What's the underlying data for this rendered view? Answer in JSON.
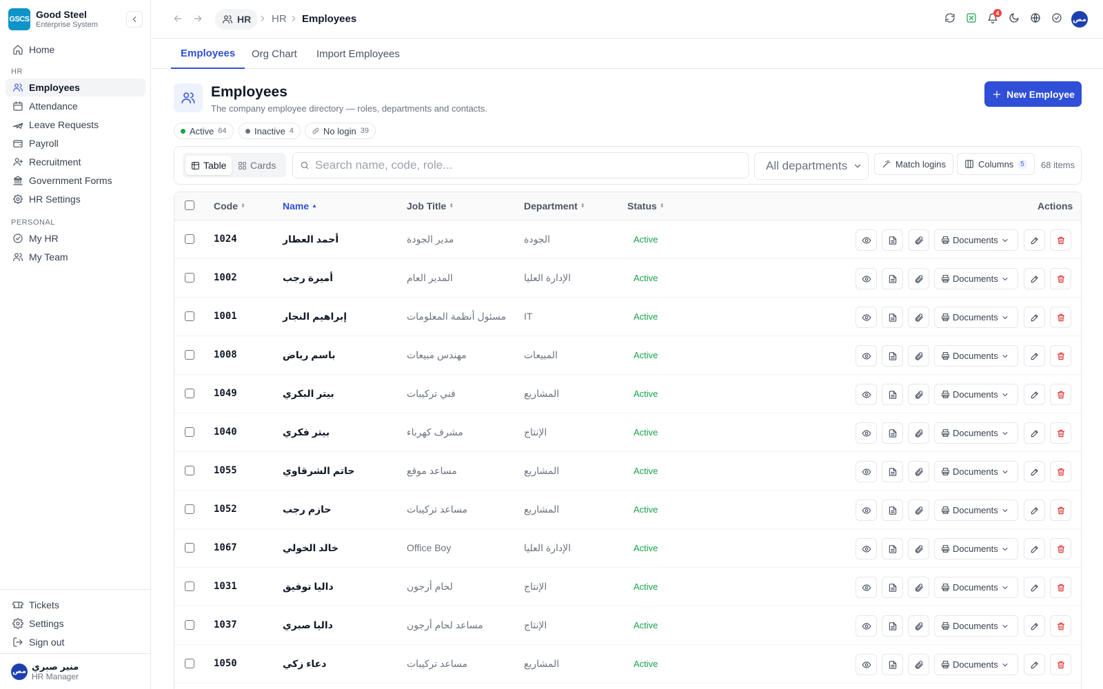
{
  "brand": {
    "logo_text": "GSCS",
    "name": "Good Steel",
    "subtitle": "Enterprise System"
  },
  "sidebar": {
    "home": "Home",
    "hr_section": "HR",
    "hr_items": [
      {
        "label": "Employees",
        "icon": "users-icon",
        "active": true
      },
      {
        "label": "Attendance",
        "icon": "calendar-icon"
      },
      {
        "label": "Leave Requests",
        "icon": "plane-icon"
      },
      {
        "label": "Payroll",
        "icon": "wallet-icon"
      },
      {
        "label": "Recruitment",
        "icon": "user-plus-icon"
      },
      {
        "label": "Government Forms",
        "icon": "landmark-icon"
      },
      {
        "label": "HR Settings",
        "icon": "cog-icon"
      }
    ],
    "personal_section": "PERSONAL",
    "personal_items": [
      {
        "label": "My HR",
        "icon": "check-circle-icon"
      },
      {
        "label": "My Team",
        "icon": "users-icon"
      }
    ],
    "bottom_items": [
      {
        "label": "Tickets",
        "icon": "ticket-icon"
      },
      {
        "label": "Settings",
        "icon": "gear-icon"
      },
      {
        "label": "Sign out",
        "icon": "logout-icon"
      }
    ],
    "user": {
      "avatar": "مص",
      "name": "منير صبري",
      "role": "HR Manager"
    }
  },
  "topbar": {
    "breadcrumb_pill": "HR",
    "breadcrumb": [
      "HR",
      "Employees"
    ],
    "notification_count": "4",
    "avatar": "مص"
  },
  "tabs": [
    "Employees",
    "Org Chart",
    "Import Employees"
  ],
  "page": {
    "title": "Employees",
    "subtitle": "The company employee directory — roles, departments and contacts.",
    "new_button": "New Employee"
  },
  "chips": [
    {
      "label": "Active",
      "count": "64",
      "color": "#16a34a"
    },
    {
      "label": "Inactive",
      "count": "4",
      "color": "#6b7280"
    },
    {
      "label": "No login",
      "count": "39",
      "color": ""
    }
  ],
  "filters": {
    "view_table": "Table",
    "view_cards": "Cards",
    "search_placeholder": "Search name, code, role...",
    "department": "All departments",
    "match_logins": "Match logins",
    "columns": "Columns",
    "columns_count": "5",
    "items": "68 items"
  },
  "table": {
    "headers": {
      "code": "Code",
      "name": "Name",
      "job_title": "Job Title",
      "department": "Department",
      "status": "Status",
      "actions": "Actions"
    },
    "documents_label": "Documents",
    "rows": [
      {
        "code": "1024",
        "name": "أحمد العطار",
        "job": "مدير الجودة",
        "dept": "الجودة",
        "status": "Active"
      },
      {
        "code": "1002",
        "name": "أميرة رجب",
        "job": "المدير العام",
        "dept": "الإدارة العليا",
        "status": "Active"
      },
      {
        "code": "1001",
        "name": "إبراهيم النجار",
        "job": "مسئول أنظمة المعلومات",
        "dept": "IT",
        "status": "Active"
      },
      {
        "code": "1008",
        "name": "باسم رياض",
        "job": "مهندس مبيعات",
        "dept": "المبيعات",
        "status": "Active"
      },
      {
        "code": "1049",
        "name": "بيتر البكري",
        "job": "فني تركيبات",
        "dept": "المشاريع",
        "status": "Active"
      },
      {
        "code": "1040",
        "name": "بيتر فكري",
        "job": "مشرف كهرباء",
        "dept": "الإنتاج",
        "status": "Active"
      },
      {
        "code": "1055",
        "name": "حاتم الشرقاوي",
        "job": "مساعد موقع",
        "dept": "المشاريع",
        "status": "Active"
      },
      {
        "code": "1052",
        "name": "حازم رجب",
        "job": "مساعد تركيبات",
        "dept": "المشاريع",
        "status": "Active"
      },
      {
        "code": "1067",
        "name": "خالد الخولي",
        "job": "Office Boy",
        "dept": "الإدارة العليا",
        "status": "Active"
      },
      {
        "code": "1031",
        "name": "داليا توفيق",
        "job": "لحام أرجون",
        "dept": "الإنتاج",
        "status": "Active"
      },
      {
        "code": "1037",
        "name": "داليا صبري",
        "job": "مساعد لحام أرجون",
        "dept": "الإنتاج",
        "status": "Active"
      },
      {
        "code": "1050",
        "name": "دعاء زكي",
        "job": "مساعد تركيبات",
        "dept": "المشاريع",
        "status": "Active"
      }
    ]
  }
}
